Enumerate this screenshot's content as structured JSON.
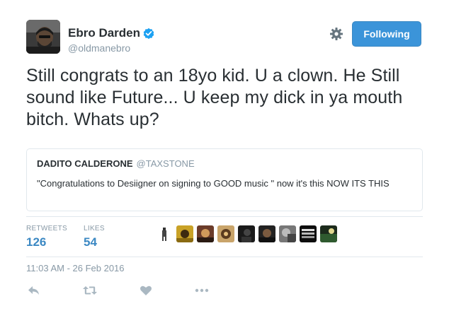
{
  "author": {
    "name": "Ebro Darden",
    "handle": "@oldmanebro",
    "verified": true,
    "avatar_icon": "user-avatar-photo"
  },
  "actions_top": {
    "settings_icon": "gear-icon",
    "follow_label": "Following",
    "accent": "#3b94d9"
  },
  "tweet": {
    "text": "Still congrats to an 18yo kid. U a clown. He Still sound like Future... U keep my dick in ya mouth bitch. Whats up?"
  },
  "quote": {
    "name": "DADITO CALDERONE",
    "handle": "@TAXSTONE",
    "text": "\"Congratulations to Desiigner on signing to GOOD music \" now it's this NOW ITS THIS"
  },
  "stats": {
    "retweets_label": "RETWEETS",
    "retweets_value": "126",
    "likes_label": "LIKES",
    "likes_value": "54"
  },
  "timestamp": "11:03 AM - 26 Feb 2016",
  "action_bar": {
    "icons": [
      "reply-icon",
      "retweet-icon",
      "like-heart-icon",
      "more-dots-icon"
    ],
    "icon_color": "#aab8c2"
  }
}
